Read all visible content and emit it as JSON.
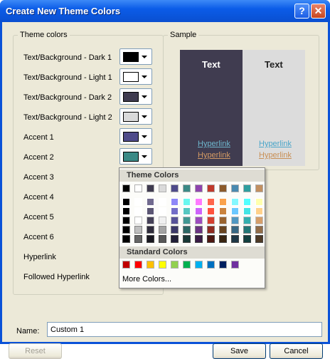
{
  "window": {
    "title": "Create New Theme Colors",
    "help_glyph": "?",
    "close_glyph": "✕"
  },
  "theme_group": {
    "title": "Theme colors",
    "rows": [
      {
        "label": "Text/Background - Dark 1",
        "color": "#000000"
      },
      {
        "label": "Text/Background - Light 1",
        "color": "#ffffff"
      },
      {
        "label": "Text/Background - Dark 2",
        "color": "#3f3b4f"
      },
      {
        "label": "Text/Background - Light 2",
        "color": "#dadada"
      },
      {
        "label": "Accent 1",
        "color": "#4f4b8a"
      },
      {
        "label": "Accent 2",
        "color": "#3b8985"
      },
      {
        "label": "Accent 3"
      },
      {
        "label": "Accent 4"
      },
      {
        "label": "Accent 5"
      },
      {
        "label": "Accent 6"
      },
      {
        "label": "Hyperlink"
      },
      {
        "label": "Followed Hyperlink"
      }
    ]
  },
  "sample": {
    "title": "Sample",
    "text": "Text",
    "hyperlink": "Hyperlink",
    "followed": "Hyperlink"
  },
  "dropdown": {
    "theme_header": "Theme Colors",
    "standard_header": "Standard Colors",
    "more": "More Colors...",
    "theme_top": [
      "#000000",
      "#ffffff",
      "#3f3b4f",
      "#dadada",
      "#4f4b8a",
      "#3b8985",
      "#8e44ad",
      "#c0392b",
      "#8b5a2b",
      "#4a8ab0",
      "#2e9e9e",
      "#c29060"
    ],
    "standard": [
      "#c00000",
      "#ff0000",
      "#ffc000",
      "#ffff00",
      "#92d050",
      "#00b050",
      "#00b0f0",
      "#0070c0",
      "#002060",
      "#7030a0"
    ]
  },
  "name": {
    "label": "Name:",
    "value": "Custom 1"
  },
  "buttons": {
    "reset": "Reset",
    "save": "Save",
    "cancel": "Cancel"
  }
}
